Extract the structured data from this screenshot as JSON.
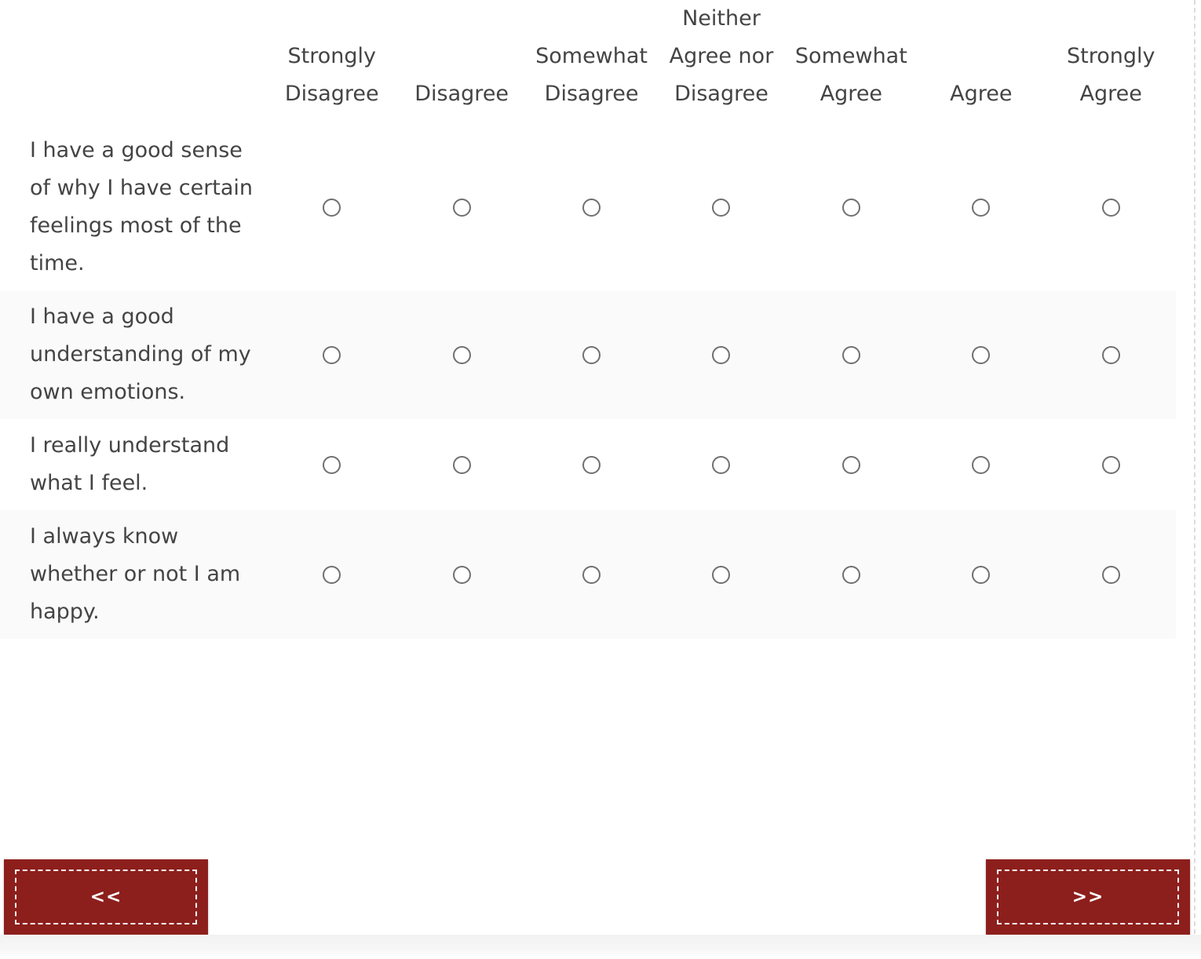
{
  "survey": {
    "scale_labels": [
      "Strongly Disagree",
      "Disagree",
      "Somewhat Disagree",
      "Neither Agree nor Disagree",
      "Somewhat Agree",
      "Agree",
      "Strongly Agree"
    ],
    "items": [
      {
        "text": "I have a good sense of why I have certain feelings most of the time.",
        "selected": null
      },
      {
        "text": "I have a good understanding of my own emotions.",
        "selected": null
      },
      {
        "text": "I really understand what I feel.",
        "selected": null
      },
      {
        "text": "I always know whether or not I am happy.",
        "selected": null
      }
    ]
  },
  "navigation": {
    "previous_label": "<<",
    "next_label": ">>"
  },
  "colors": {
    "button_background": "#8c1f1c",
    "button_text": "#ffffff",
    "text": "#444444",
    "row_stripe": "#fafafa",
    "radio_border": "#707070"
  }
}
